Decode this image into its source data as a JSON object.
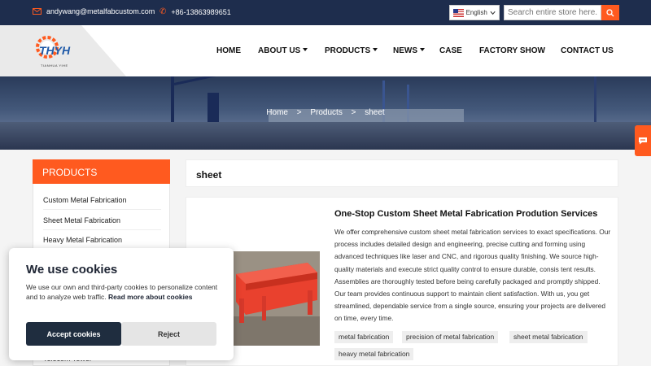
{
  "topbar": {
    "email": "andywang@metalfabcustom.com",
    "phone": "+86-13863989651",
    "language": "English",
    "search_placeholder": "Search entire store here..."
  },
  "logo": {
    "text": "THYH",
    "sub": "TIANHUA YIHE"
  },
  "nav": [
    {
      "label": "HOME"
    },
    {
      "label": "ABOUT US"
    },
    {
      "label": "PRODUCTS"
    },
    {
      "label": "NEWS"
    },
    {
      "label": "CASE"
    },
    {
      "label": "FACTORY SHOW"
    },
    {
      "label": "CONTACT US"
    }
  ],
  "breadcrumb": {
    "home": "Home",
    "sep": ">",
    "products": "Products",
    "current": "sheet"
  },
  "sidebar": {
    "title": "PRODUCTS",
    "items": [
      {
        "label": "Custom Metal Fabrication"
      },
      {
        "label": "Sheet Metal Fabrication"
      },
      {
        "label": "Heavy Metal Fabrication"
      },
      {
        "label": "Telecom Tower"
      }
    ]
  },
  "main": {
    "title": "sheet",
    "product": {
      "title": "One-Stop Custom Sheet Metal Fabrication Prodution Services",
      "description": "We offer comprehensive custom sheet metal fabrication services to exact specifications. Our process includes detailed design and engineering, precise cutting and forming using advanced techniques like laser and CNC, and rigorous quality finishing. We source high-quality materials and execute strict quality control to ensure durable, consis tent results. Assemblies are thoroughly tested before being carefully packaged and promptly shipped. Our team provides continuous support to maintain client satisfaction. With us, you get streamlined, dependable service from a single source, ensuring your projects are delivered on time, every time.",
      "tags": [
        "metal fabrication",
        "precision of metal fabrication",
        "sheet metal fabrication",
        "heavy metal fabrication"
      ]
    }
  },
  "cookie": {
    "title": "We use cookies",
    "text": "We use our own and third-party cookies to personalize content and to analyze web traffic.",
    "link": "Read more about cookies",
    "accept": "Accept cookies",
    "reject": "Reject"
  },
  "colors": {
    "accent": "#ff5a1f",
    "topbar": "#1e2d4d",
    "cookie_button": "#1f2d3f"
  }
}
